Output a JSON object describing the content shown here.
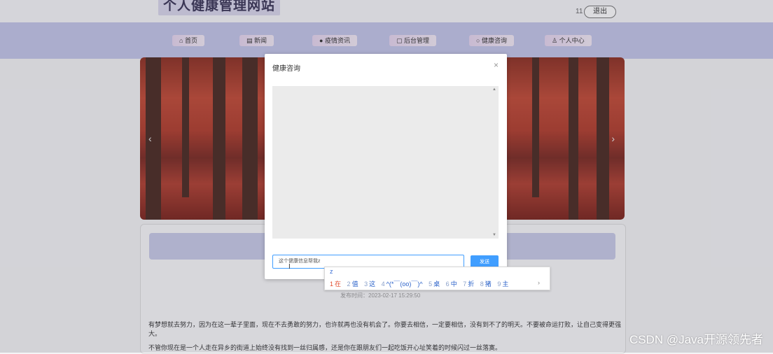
{
  "header": {
    "site_title": "个人健康管理网站",
    "username": "11",
    "logout_label": "退出"
  },
  "nav": {
    "items": [
      {
        "label": "首页",
        "icon": "home-icon"
      },
      {
        "label": "新闻",
        "icon": "news-icon"
      },
      {
        "label": "疫情资讯",
        "icon": "info-icon"
      },
      {
        "label": "后台管理",
        "icon": "admin-icon"
      },
      {
        "label": "健康咨询",
        "icon": "consult-icon"
      },
      {
        "label": "个人中心",
        "icon": "user-icon"
      }
    ]
  },
  "article": {
    "time_label": "发布时间：2023-02-17 15:29:50",
    "para1": "有梦想就去努力，因为在这一辈子里面，现在不去勇敢的努力，也许就再也没有机会了。你要去相信，一定要相信，没有到不了的明天。不要被命运打败，让自己变得更强大。",
    "para2": "不管你现在是一个人走在异乡的街道上始终没有找到一丝归属感，还是你在跟朋友们一起吃饭开心址笑着的时候闪过一丝落寞。"
  },
  "dialog": {
    "title": "健康咨询",
    "close_icon": "close-icon",
    "input_value": "这个健康信息帮我z",
    "send_label": "发送"
  },
  "ime": {
    "composition": "z",
    "candidates": [
      {
        "num": "1",
        "text": "在"
      },
      {
        "num": "2",
        "text": "值"
      },
      {
        "num": "3",
        "text": "这"
      },
      {
        "num": "4",
        "text": "^(*￣(oo)￣)^"
      },
      {
        "num": "5",
        "text": "桌"
      },
      {
        "num": "6",
        "text": "中"
      },
      {
        "num": "7",
        "text": "折"
      },
      {
        "num": "8",
        "text": "猪"
      },
      {
        "num": "9",
        "text": "主"
      }
    ],
    "next_symbol": "›"
  },
  "watermark": "CSDN @Java开源领先者",
  "colors": {
    "accent": "#409eff",
    "nav_bg": "#c4c6ea",
    "ime_first": "#e04a2b"
  }
}
